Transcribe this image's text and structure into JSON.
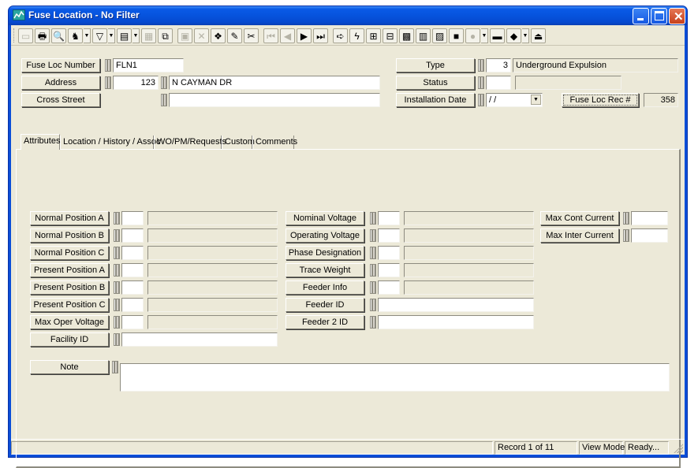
{
  "window": {
    "title": "Fuse Location - No Filter",
    "icon": "app-chart-icon",
    "controls": {
      "minimize": "minimize-icon",
      "maximize": "maximize-icon",
      "close": "close-icon"
    }
  },
  "toolbar": {
    "buttons": [
      {
        "name": "record-view",
        "icon": "window-icon",
        "glyph": "▭",
        "enabled": false
      },
      {
        "name": "print",
        "icon": "printer-icon",
        "glyph": "🖶",
        "enabled": true
      },
      {
        "name": "preview",
        "icon": "magnify-icon",
        "glyph": "🔍",
        "enabled": true
      },
      {
        "name": "search",
        "icon": "binoculars-icon",
        "glyph": "♞",
        "enabled": true,
        "dropdown": true
      },
      {
        "name": "filter",
        "icon": "funnel-icon",
        "glyph": "▽",
        "enabled": true,
        "dropdown": true
      },
      {
        "name": "report",
        "icon": "document-icon",
        "glyph": "▤",
        "enabled": true,
        "dropdown": true
      },
      {
        "name": "properties",
        "icon": "properties-icon",
        "glyph": "▦",
        "enabled": false
      },
      {
        "name": "copy-record",
        "icon": "copy-icon",
        "glyph": "⧉",
        "enabled": true
      },
      {
        "name": "save",
        "icon": "save-icon",
        "glyph": "▣",
        "enabled": false
      },
      {
        "name": "delete",
        "icon": "delete-icon",
        "glyph": "✕",
        "enabled": false
      },
      {
        "name": "add",
        "icon": "add-record-icon",
        "glyph": "❖",
        "enabled": true
      },
      {
        "name": "edit",
        "icon": "pencil-icon",
        "glyph": "✎",
        "enabled": true
      },
      {
        "name": "cut",
        "icon": "scissors-icon",
        "glyph": "✂",
        "enabled": true
      },
      {
        "name": "first",
        "icon": "first-record-icon",
        "glyph": "⏮",
        "enabled": false
      },
      {
        "name": "previous",
        "icon": "previous-record-icon",
        "glyph": "◀",
        "enabled": false
      },
      {
        "name": "next",
        "icon": "next-record-icon",
        "glyph": "▶",
        "enabled": true
      },
      {
        "name": "last",
        "icon": "last-record-icon",
        "glyph": "⏭",
        "enabled": true
      },
      {
        "name": "goto",
        "icon": "arrow-right-icon",
        "glyph": "➪",
        "enabled": true
      },
      {
        "name": "trace",
        "icon": "lightning-icon",
        "glyph": "ϟ",
        "enabled": true
      },
      {
        "name": "map",
        "icon": "map-icon",
        "glyph": "⊞",
        "enabled": true
      },
      {
        "name": "network",
        "icon": "network-icon",
        "glyph": "⊟",
        "enabled": true
      },
      {
        "name": "equipment",
        "icon": "equipment-icon",
        "glyph": "▩",
        "enabled": true
      },
      {
        "name": "archive",
        "icon": "cabinet-icon",
        "glyph": "▥",
        "enabled": true
      },
      {
        "name": "linked",
        "icon": "linked-items-icon",
        "glyph": "▨",
        "enabled": true
      },
      {
        "name": "toolbox",
        "icon": "toolbox-icon",
        "glyph": "■",
        "enabled": true
      },
      {
        "name": "globe",
        "icon": "globe-icon",
        "glyph": "●",
        "enabled": false,
        "dropdown": true
      },
      {
        "name": "calculator",
        "icon": "calculator-icon",
        "glyph": "▬",
        "enabled": true
      },
      {
        "name": "book",
        "icon": "book-icon",
        "glyph": "◆",
        "enabled": true,
        "dropdown": true
      },
      {
        "name": "exit",
        "icon": "exit-icon",
        "glyph": "⏏",
        "enabled": true
      }
    ]
  },
  "header": {
    "fuse_loc_number": {
      "label": "Fuse Loc Number",
      "value": "FLN1"
    },
    "address": {
      "label": "Address",
      "number": "123",
      "street": "N CAYMAN DR"
    },
    "cross_street": {
      "label": "Cross Street",
      "value": ""
    },
    "type": {
      "label": "Type",
      "code": "3",
      "description": "Underground Expulsion"
    },
    "status": {
      "label": "Status",
      "code": "",
      "description": ""
    },
    "installation_date": {
      "label": "Installation Date",
      "value": " / /"
    },
    "rec_no": {
      "label": "Fuse Loc Rec #",
      "value": "358"
    }
  },
  "tabs": [
    {
      "label": "Attributes",
      "active": true
    },
    {
      "label": "Location / History / Assoc",
      "active": false
    },
    {
      "label": "WO/PM/Requests",
      "active": false
    },
    {
      "label": "Custom",
      "active": false
    },
    {
      "label": "Comments",
      "active": false
    }
  ],
  "attributes": {
    "col1": [
      {
        "label": "Normal Position A",
        "code": "",
        "description": ""
      },
      {
        "label": "Normal Position B",
        "code": "",
        "description": ""
      },
      {
        "label": "Normal Position C",
        "code": "",
        "description": ""
      },
      {
        "label": "Present Position A",
        "code": "",
        "description": ""
      },
      {
        "label": "Present Position B",
        "code": "",
        "description": ""
      },
      {
        "label": "Present Position C",
        "code": "",
        "description": ""
      },
      {
        "label": "Max Oper Voltage",
        "code": "",
        "description": ""
      }
    ],
    "facility_id": {
      "label": "Facility ID",
      "value": ""
    },
    "col2": [
      {
        "label": "Nominal Voltage",
        "code": "",
        "description": ""
      },
      {
        "label": "Operating Voltage",
        "code": "",
        "description": ""
      },
      {
        "label": "Phase Designation",
        "code": "",
        "description": ""
      },
      {
        "label": "Trace Weight",
        "code": "",
        "description": ""
      },
      {
        "label": "Feeder Info",
        "code": "",
        "description": ""
      }
    ],
    "feeder_id": {
      "label": "Feeder ID",
      "value": ""
    },
    "feeder_2_id": {
      "label": "Feeder 2 ID",
      "value": ""
    },
    "col3": [
      {
        "label": "Max Cont Current",
        "value": ""
      },
      {
        "label": "Max Inter Current",
        "value": ""
      }
    ],
    "note": {
      "label": "Note",
      "value": ""
    }
  },
  "statusbar": {
    "record": "Record 1 of 11",
    "mode": "View Mode",
    "state": "Ready..."
  }
}
